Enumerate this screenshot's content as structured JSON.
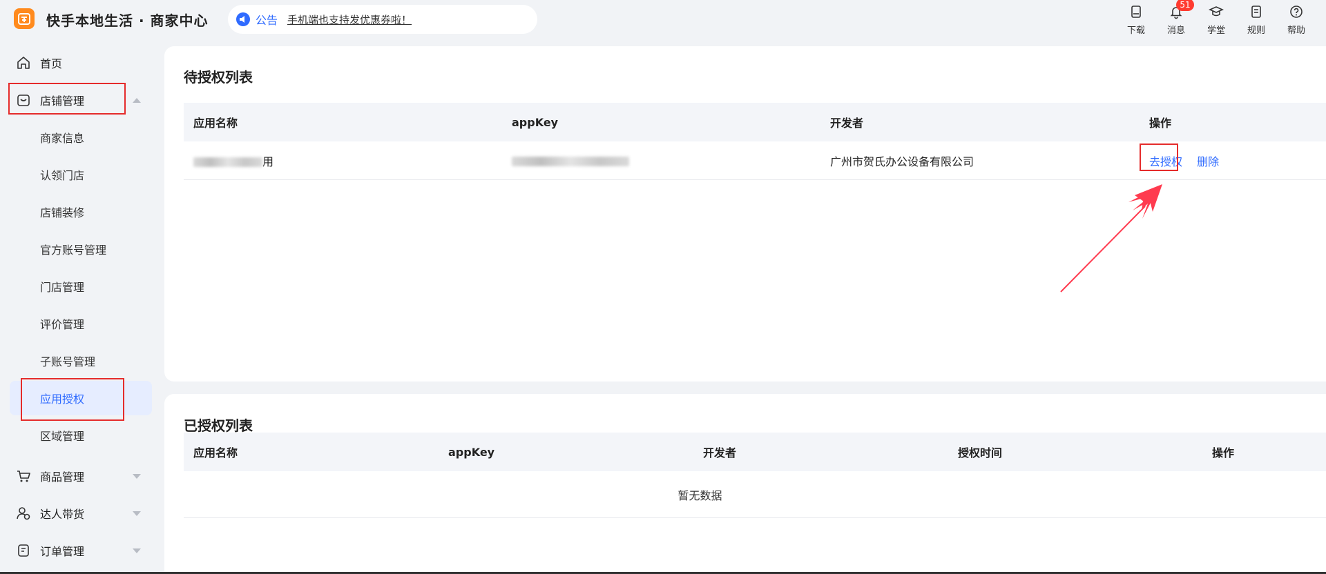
{
  "header": {
    "app_title": "快手本地生活 · 商家中心",
    "notice_label": "公告",
    "notice_text": "手机端也支持发优惠券啦！",
    "actions": [
      {
        "label": "下载",
        "icon": "download-icon"
      },
      {
        "label": "消息",
        "icon": "bell-icon",
        "badge": "51"
      },
      {
        "label": "学堂",
        "icon": "graduation-cap-icon"
      },
      {
        "label": "规则",
        "icon": "document-icon"
      },
      {
        "label": "帮助",
        "icon": "help-icon"
      }
    ]
  },
  "sidebar": {
    "home": "首页",
    "store_mgmt": "店铺管理",
    "sub_items": [
      "商家信息",
      "认领门店",
      "店铺装修",
      "官方账号管理",
      "门店管理",
      "评价管理",
      "子账号管理",
      "应用授权",
      "区域管理"
    ],
    "goods_mgmt": "商品管理",
    "influencer": "达人带货",
    "orders": "订单管理"
  },
  "pending": {
    "title": "待授权列表",
    "columns": [
      "应用名称",
      "appKey",
      "开发者",
      "操作"
    ],
    "rows": [
      {
        "app_name_tail": "用",
        "developer": "广州市贺氏办公设备有限公司",
        "action_authorize": "去授权",
        "action_delete": "删除"
      }
    ]
  },
  "authorized": {
    "title": "已授权列表",
    "columns": [
      "应用名称",
      "appKey",
      "开发者",
      "授权时间",
      "操作"
    ],
    "empty_text": "暂无数据"
  },
  "colors": {
    "accent": "#2f6bff",
    "highlight": "#e52b2b",
    "badge": "#ff3b30",
    "logo": "#ff8a1d"
  }
}
